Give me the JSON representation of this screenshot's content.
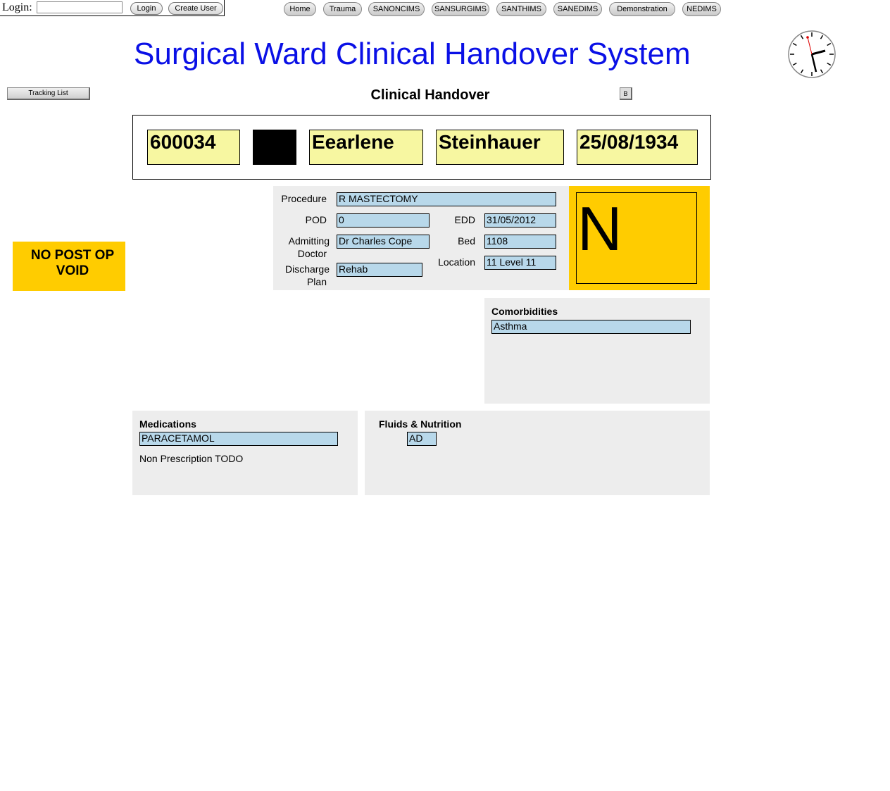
{
  "login": {
    "label": "Login:",
    "input_value": "",
    "login_button": "Login",
    "create_user_button": "Create User"
  },
  "nav": [
    "Home",
    "Trauma",
    "SANONCIMS",
    "SANSURGIMS",
    "SANTHIMS",
    "SANEDIMS",
    "Demonstration",
    "NEDIMS"
  ],
  "app_title": "Surgical Ward Clinical Handover System",
  "tracking_list_button": "Tracking List",
  "section_title": "Clinical Handover",
  "b_button": "B",
  "patient": {
    "id": "600034",
    "first_name": "Eearlene",
    "last_name": "Steinhauer",
    "dob": "25/08/1934"
  },
  "details": {
    "procedure_label": "Procedure",
    "procedure": "R MASTECTOMY",
    "pod_label": "POD",
    "pod": "0",
    "edd_label": "EDD",
    "edd": "31/05/2012",
    "admitting_label_1": "Admitting",
    "admitting_label_2": "Doctor",
    "admitting_doctor": "Dr Charles Cope",
    "bed_label": "Bed",
    "bed": "1108",
    "discharge_label_1": "Discharge",
    "discharge_label_2": "Plan",
    "discharge_plan": "Rehab",
    "location_label": "Location",
    "location": "11 Level 11"
  },
  "status_letter": "N",
  "void_notice": {
    "line1": "NO POST OP",
    "line2": "VOID"
  },
  "comorbidities": {
    "title": "Comorbidities",
    "items": [
      "Asthma"
    ]
  },
  "medications": {
    "title": "Medications",
    "items": [
      "PARACETAMOL"
    ],
    "note": "Non Prescription TODO"
  },
  "fluids": {
    "title": "Fluids & Nutrition",
    "value": "AD"
  },
  "colors": {
    "title_blue": "#0a10e6",
    "patient_yellow": "#f7f7a1",
    "status_orange": "#ffcc00",
    "field_blue": "#b8d8ea",
    "panel_grey": "#ededed"
  }
}
